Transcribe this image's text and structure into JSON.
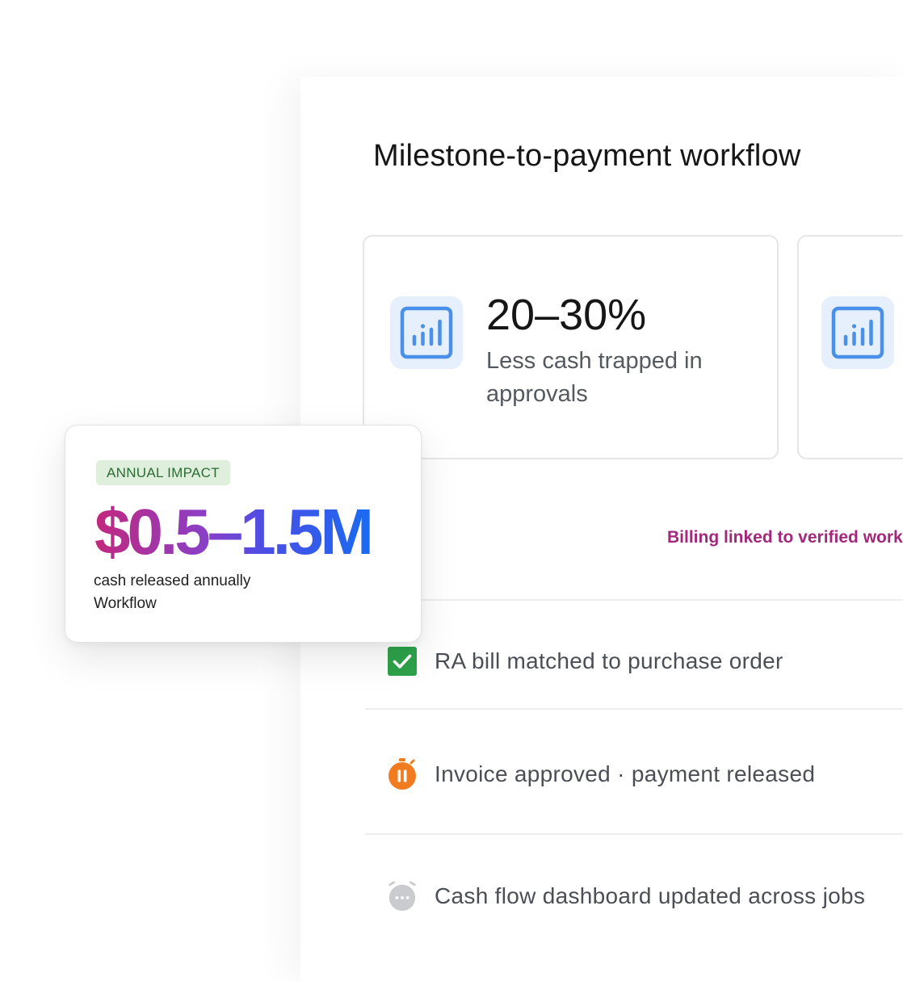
{
  "workflow": {
    "title": "Milestone-to-payment workflow",
    "billing_label": "Billing linked to verified work",
    "steps": [
      {
        "label": "RA bill matched to purchase order",
        "status": "done",
        "icon": "check-icon",
        "color": "#2ea24a"
      },
      {
        "label": "Invoice approved · payment released",
        "status": "paused",
        "icon": "pause-timer-icon",
        "color": "#f07c1f"
      },
      {
        "label": "Cash flow dashboard updated across jobs",
        "status": "pending",
        "icon": "pending-timer-icon",
        "color": "#c9cbce"
      }
    ]
  },
  "stat_cards": [
    {
      "icon": "bar-chart-icon",
      "value": "20–30%",
      "label": "Less cash trapped in approvals"
    },
    {
      "icon": "bar-chart-icon",
      "value": "",
      "label": ""
    }
  ],
  "impact_card": {
    "badge": "ANNUAL IMPACT",
    "value": "$0.5–1.5M",
    "caption": "cash released annually",
    "source": "Workflow"
  },
  "colors": {
    "accent_blue": "#1a6bf0",
    "accent_magenta": "#c2287d",
    "billing_label": "#a3287b",
    "badge_bg": "#deefdc",
    "badge_text": "#2e6b34",
    "icon_tile_bg": "#e6f0fd",
    "icon_stroke": "#4a90e8"
  }
}
